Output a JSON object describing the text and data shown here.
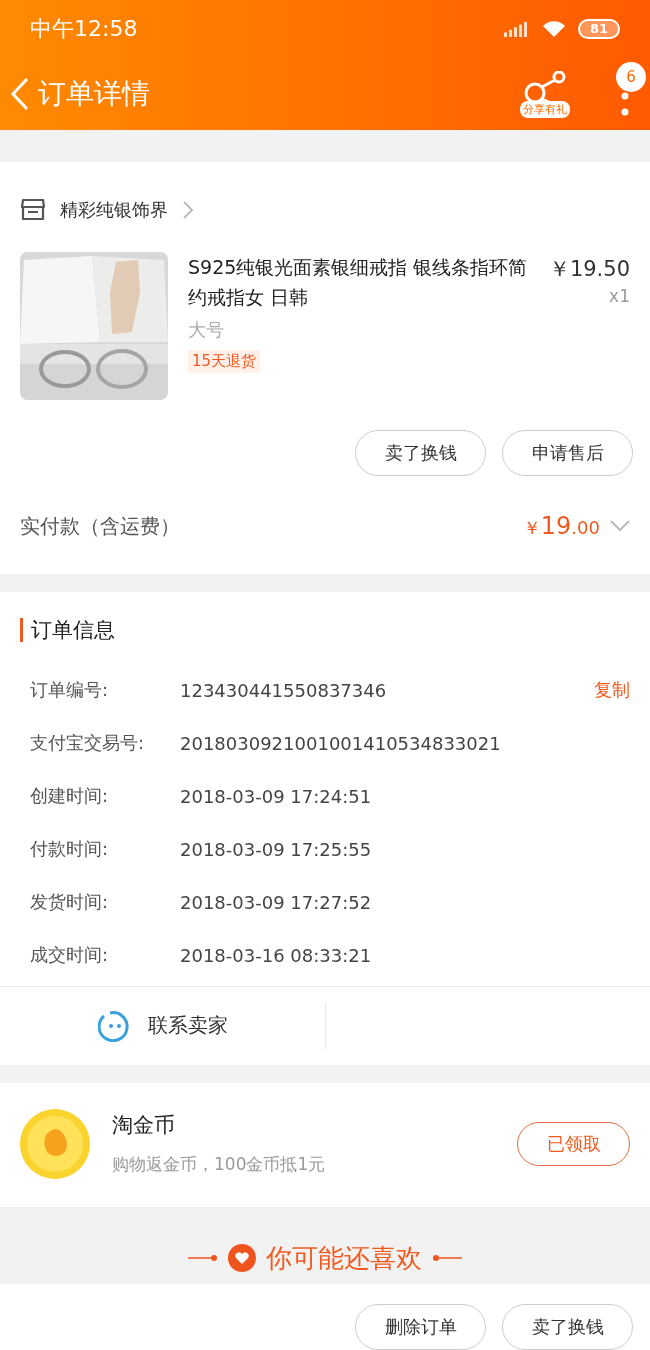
{
  "status_bar": {
    "time": "中午12:58",
    "battery": "81"
  },
  "nav": {
    "title": "订单详情",
    "share_label": "分享有礼",
    "badge": "6"
  },
  "shop": {
    "name": "精彩纯银饰界"
  },
  "product": {
    "title": "S925纯银光面素银细戒指 银线条指环简约戒指女 日韩",
    "price": "￥19.50",
    "qty": "x1",
    "spec": "大号",
    "tag": "15天退货",
    "actions": [
      "卖了换钱",
      "申请售后"
    ]
  },
  "payment": {
    "label": "实付款（含运费）",
    "currency": "￥",
    "amount_int": "19",
    "amount_dec": ".00"
  },
  "order_info": {
    "title": "订单信息",
    "copy": "复制",
    "rows": [
      {
        "label": "订单编号:",
        "value": "123430441550837346"
      },
      {
        "label": "支付宝交易号:",
        "value": "2018030921001001410534833021"
      },
      {
        "label": "创建时间:",
        "value": "2018-03-09 17:24:51"
      },
      {
        "label": "付款时间:",
        "value": "2018-03-09 17:25:55"
      },
      {
        "label": "发货时间:",
        "value": "2018-03-09 17:27:52"
      },
      {
        "label": "成交时间:",
        "value": "2018-03-16 08:33:21"
      }
    ],
    "contact": "联系卖家"
  },
  "coins": {
    "title": "淘金币",
    "desc": "购物返金币，100金币抵1元",
    "button": "已领取"
  },
  "recommend": {
    "title": "你可能还喜欢"
  },
  "bottom_actions": [
    "删除订单",
    "卖了换钱"
  ]
}
